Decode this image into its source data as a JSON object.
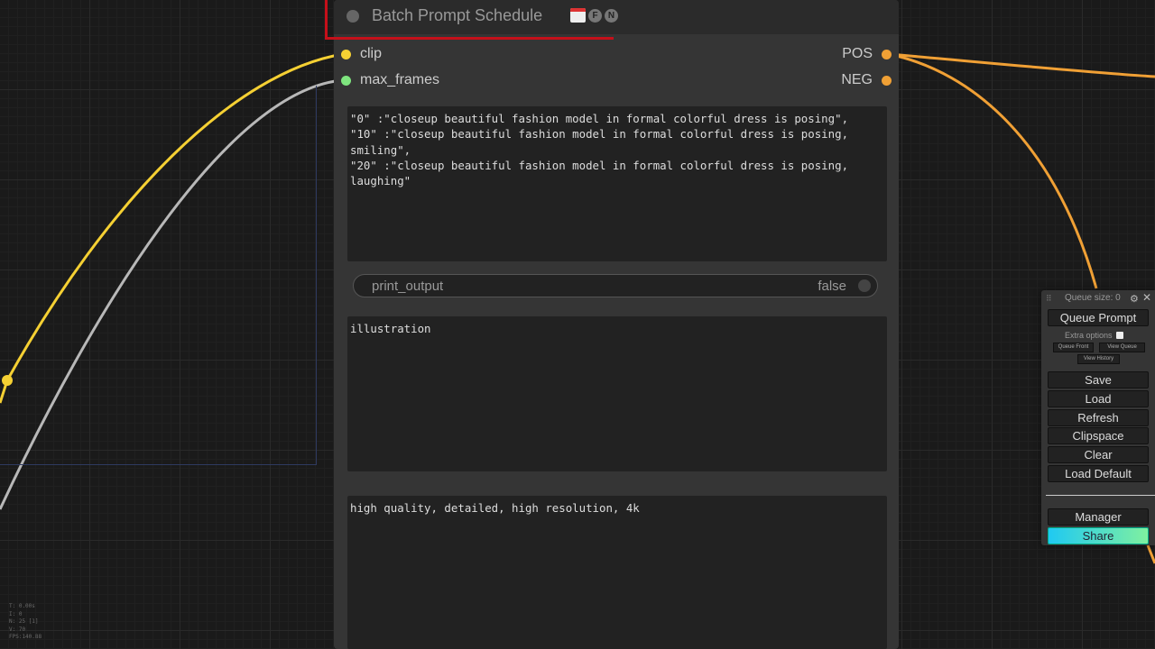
{
  "node": {
    "title": "Batch Prompt Schedule",
    "badges": {
      "f": "F",
      "n": "N"
    },
    "inputs": [
      {
        "label": "clip",
        "color": "#f5d033"
      },
      {
        "label": "max_frames",
        "color": "#7fe57f"
      }
    ],
    "outputs": [
      {
        "label": "POS",
        "color": "#f0a035"
      },
      {
        "label": "NEG",
        "color": "#f0a035"
      }
    ],
    "schedule_text": "\"0\" :\"closeup beautiful fashion model in formal colorful dress is posing\",\n\"10\" :\"closeup beautiful fashion model in formal colorful dress is posing, smiling\",\n\"20\" :\"closeup beautiful fashion model in formal colorful dress is posing, laughing\"",
    "print_output": {
      "name": "print_output",
      "value": "false"
    },
    "pre_text": "illustration",
    "app_text": "high quality, detailed, high resolution, 4k"
  },
  "menu": {
    "queue_size": "Queue size: 0",
    "queue_prompt": "Queue Prompt",
    "extra_options": "Extra options",
    "queue_front": "Queue Front",
    "view_queue": "View Queue",
    "view_history": "View History",
    "save": "Save",
    "load": "Load",
    "refresh": "Refresh",
    "clipspace": "Clipspace",
    "clear": "Clear",
    "load_default": "Load Default",
    "manager": "Manager",
    "share": "Share"
  },
  "stats": {
    "lines": "T: 0.00s\nI: 0\nN: 25 [1]\nV: 70\nFPS:140.88"
  },
  "wire_colors": {
    "clip": "#f5d033",
    "frames": "#b8b8b8",
    "output": "#f0a035"
  }
}
